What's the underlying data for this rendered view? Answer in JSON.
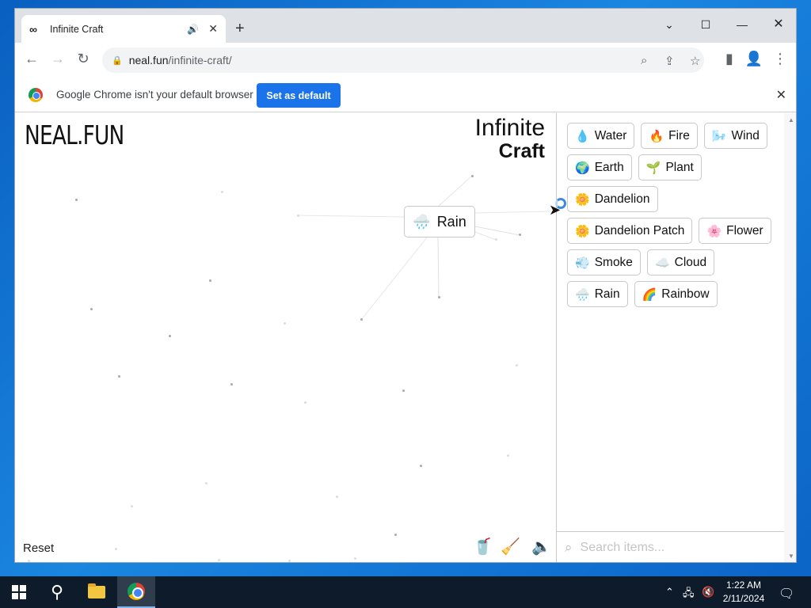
{
  "browser": {
    "tab_title": "Infinite Craft",
    "tab_favicon": "∞",
    "url_host": "neal.fun",
    "url_path": "/infinite-craft/",
    "infobar_message": "Google Chrome isn't your default browser",
    "infobar_button": "Set as default"
  },
  "page": {
    "brand": "NEAL.FUN",
    "title_line1": "Infinite",
    "title_line2": "Craft",
    "canvas_item": {
      "label": "Rain",
      "icon": "🌧️"
    },
    "reset_label": "Reset",
    "search_placeholder": "Search items..."
  },
  "items": [
    {
      "label": "Water",
      "icon": "💧"
    },
    {
      "label": "Fire",
      "icon": "🔥"
    },
    {
      "label": "Wind",
      "icon": "🌬️"
    },
    {
      "label": "Earth",
      "icon": "🌍"
    },
    {
      "label": "Plant",
      "icon": "🌱"
    },
    {
      "label": "Dandelion",
      "icon": "🌼"
    },
    {
      "label": "Dandelion Patch",
      "icon": "🌼"
    },
    {
      "label": "Flower",
      "icon": "🌸"
    },
    {
      "label": "Smoke",
      "icon": "💨"
    },
    {
      "label": "Cloud",
      "icon": "☁️"
    },
    {
      "label": "Rain",
      "icon": "🌧️"
    },
    {
      "label": "Rainbow",
      "icon": "🌈"
    }
  ],
  "taskbar": {
    "time": "1:22 AM",
    "date": "2/11/2024"
  }
}
